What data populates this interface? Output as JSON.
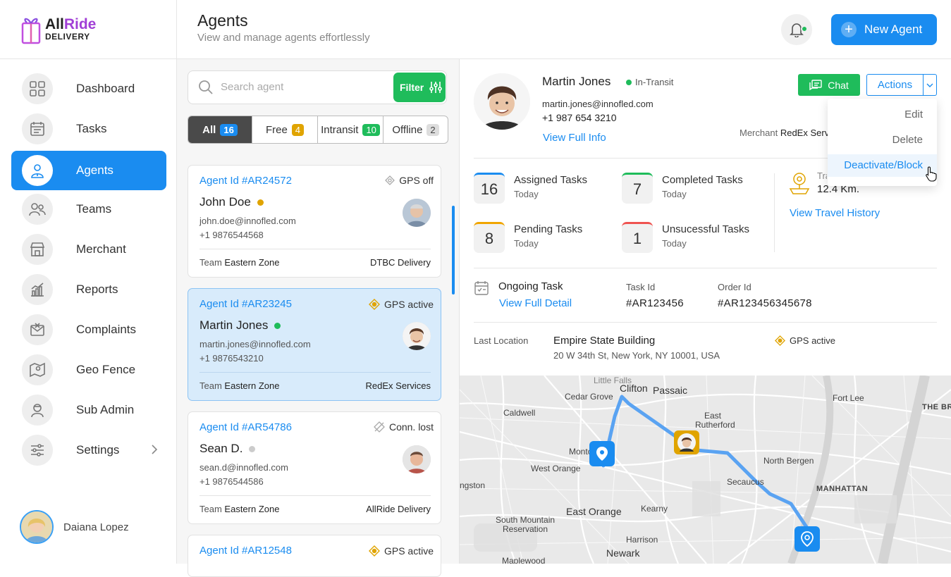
{
  "brand": {
    "name_part1": "All",
    "name_part2": "Ride",
    "sub": "DELIVERY"
  },
  "sidebar": {
    "items": [
      {
        "label": "Dashboard",
        "icon": "dashboard-icon"
      },
      {
        "label": "Tasks",
        "icon": "calendar-icon"
      },
      {
        "label": "Agents",
        "icon": "agent-icon",
        "active": true
      },
      {
        "label": "Teams",
        "icon": "team-icon"
      },
      {
        "label": "Merchant",
        "icon": "store-icon"
      },
      {
        "label": "Reports",
        "icon": "chart-icon"
      },
      {
        "label": "Complaints",
        "icon": "complaint-icon"
      },
      {
        "label": "Geo Fence",
        "icon": "map-pin-icon"
      },
      {
        "label": "Sub Admin",
        "icon": "admin-icon"
      },
      {
        "label": "Settings",
        "icon": "sliders-icon"
      }
    ],
    "user_name": "Daiana Lopez"
  },
  "header": {
    "title": "Agents",
    "subtitle": "View and manage agents effortlessly",
    "new_agent_label": "New Agent"
  },
  "list": {
    "search_placeholder": "Search agent",
    "filter_label": "Filter",
    "tabs": [
      {
        "label": "All",
        "count": "16"
      },
      {
        "label": "Free",
        "count": "4"
      },
      {
        "label": "Intransit",
        "count": "10"
      },
      {
        "label": "Offline",
        "count": "2"
      }
    ],
    "team_prefix": "Team",
    "agents": [
      {
        "id": "Agent Id #AR24572",
        "gps": "GPS off",
        "name": "John Doe",
        "status_color": "#e0a400",
        "email": "john.doe@innofled.com",
        "phone": "+1 9876544568",
        "team": "Eastern Zone",
        "merchant": "DTBC Delivery"
      },
      {
        "id": "Agent Id #AR23245",
        "gps": "GPS active",
        "name": "Martin Jones",
        "status_color": "#1fbc5b",
        "email": "martin.jones@innofled.com",
        "phone": "+1 9876543210",
        "team": "Eastern Zone",
        "merchant": "RedEx Services"
      },
      {
        "id": "Agent Id #AR54786",
        "gps": "Conn. lost",
        "name": "Sean D.",
        "status_color": "#cccccc",
        "email": "sean.d@innofled.com",
        "phone": "+1 9876544586",
        "team": "Eastern Zone",
        "merchant": "AllRide Delivery"
      },
      {
        "id": "Agent Id #AR12548",
        "gps": "GPS active"
      }
    ]
  },
  "detail": {
    "name": "Martin Jones",
    "status": "In-Transit",
    "email": "martin.jones@innofled.com",
    "phone": "+1 987 654 3210",
    "view_info": "View Full Info",
    "merchant_label": "Merchant",
    "merchant": "RedEx Serv",
    "chat_label": "Chat",
    "actions_label": "Actions",
    "dropdown": [
      "Edit",
      "Delete",
      "Deactivate/Block"
    ],
    "stats": [
      {
        "value": "16",
        "label": "Assigned Tasks",
        "sub": "Today",
        "color": "#1a8cf0"
      },
      {
        "value": "7",
        "label": "Completed Tasks",
        "sub": "Today",
        "color": "#1fbc5b"
      },
      {
        "value": "8",
        "label": "Pending Tasks",
        "sub": "Today",
        "color": "#f0a500"
      },
      {
        "value": "1",
        "label": "Unsucessful Tasks",
        "sub": "Today",
        "color": "#ef5350"
      }
    ],
    "travel_label": "Tra",
    "travel_value": "12.4 Km.",
    "travel_link": "View Travel History",
    "ongoing_label": "Ongoing Task",
    "ongoing_link": "View Full Detail",
    "task_id_label": "Task Id",
    "task_id": "#AR123456",
    "order_id_label": "Order Id",
    "order_id": "#AR123456345678",
    "last_location_label": "Last Location",
    "location_name": "Empire State Building",
    "location_addr": "20 W 34th St, New York, NY 10001, USA",
    "location_gps": "GPS active"
  },
  "map": {
    "places": [
      "Clifton",
      "Passaic",
      "Cedar Grove",
      "Caldwell",
      "East Rutherford",
      "Fort Lee",
      "THE BRO",
      "Montclair",
      "West Orange",
      "North Bergen",
      "ngston",
      "Secaucus",
      "MANHATTAN",
      "East Orange",
      "Kearny",
      "South Mountain Reservation",
      "Harrison",
      "Newark",
      "Maplewood",
      "Little Falls"
    ]
  },
  "colors": {
    "accent": "#1a8cf0",
    "success": "#1fbc5b",
    "warning": "#e0a400"
  }
}
